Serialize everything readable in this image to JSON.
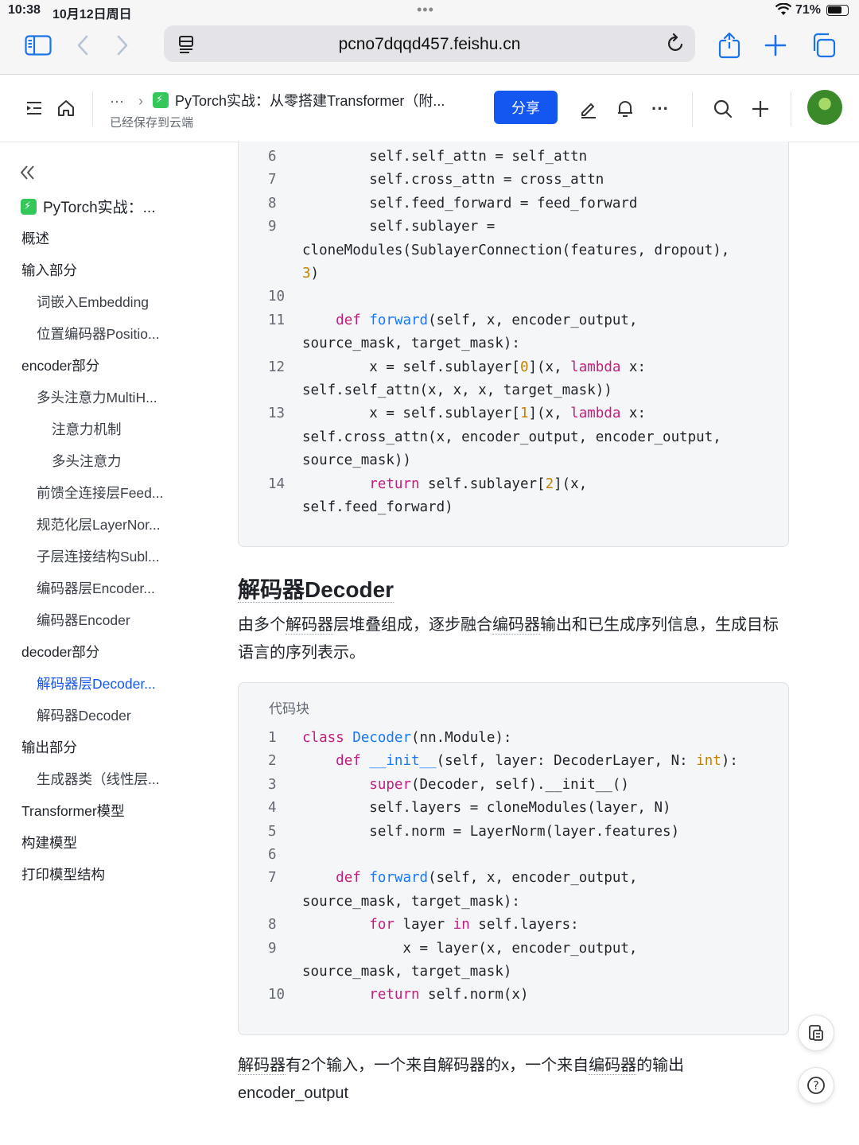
{
  "status": {
    "time": "10:38",
    "date": "10月12日周日",
    "battery": "71%"
  },
  "browser": {
    "url": "pcno7dqqd457.feishu.cn"
  },
  "doc": {
    "crumb_ellipsis": "···",
    "title": "PyTorch实战：从零搭建Transformer（附...",
    "saved": "已经保存到云端",
    "share_label": "分享"
  },
  "toc": {
    "title": "PyTorch实战：...",
    "items": [
      {
        "label": "概述",
        "level": 1
      },
      {
        "label": "输入部分",
        "level": 1
      },
      {
        "label": "词嵌入Embedding",
        "level": 2
      },
      {
        "label": "位置编码器Positio...",
        "level": 2
      },
      {
        "label": "encoder部分",
        "level": 1
      },
      {
        "label": "多头注意力MultiH...",
        "level": 2
      },
      {
        "label": "注意力机制",
        "level": 3
      },
      {
        "label": "多头注意力",
        "level": 3
      },
      {
        "label": "前馈全连接层Feed...",
        "level": 2
      },
      {
        "label": "规范化层LayerNor...",
        "level": 2
      },
      {
        "label": "子层连接结构Subl...",
        "level": 2
      },
      {
        "label": "编码器层Encoder...",
        "level": 2
      },
      {
        "label": "编码器Encoder",
        "level": 2
      },
      {
        "label": "decoder部分",
        "level": 1
      },
      {
        "label": "解码器层Decoder...",
        "level": 2,
        "active": true
      },
      {
        "label": "解码器Decoder",
        "level": 2
      },
      {
        "label": "输出部分",
        "level": 1
      },
      {
        "label": "生成器类（线性层...",
        "level": 2
      },
      {
        "label": "Transformer模型",
        "level": 1
      },
      {
        "label": "构建模型",
        "level": 1
      },
      {
        "label": "打印模型结构",
        "level": 1
      }
    ]
  },
  "code1": {
    "lines": [
      {
        "n": "6",
        "t": "        self.self_attn = self_attn"
      },
      {
        "n": "7",
        "t": "        self.cross_attn = cross_attn"
      },
      {
        "n": "8",
        "t": "        self.feed_forward = feed_forward"
      },
      {
        "n": "9",
        "t": "        self.sublayer ="
      },
      {
        "n": "",
        "t": "cloneModules(SublayerConnection(features, dropout),"
      },
      {
        "n": "",
        "t": "3)"
      },
      {
        "n": "10",
        "t": ""
      },
      {
        "n": "11",
        "t": "    def forward(self, x, encoder_output,"
      },
      {
        "n": "",
        "t": "source_mask, target_mask):"
      },
      {
        "n": "12",
        "t": "        x = self.sublayer[0](x, lambda x:"
      },
      {
        "n": "",
        "t": "self.self_attn(x, x, x, target_mask))"
      },
      {
        "n": "13",
        "t": "        x = self.sublayer[1](x, lambda x:"
      },
      {
        "n": "",
        "t": "self.cross_attn(x, encoder_output, encoder_output,"
      },
      {
        "n": "",
        "t": "source_mask))"
      },
      {
        "n": "14",
        "t": "        return self.sublayer[2](x,"
      },
      {
        "n": "",
        "t": "self.feed_forward)"
      }
    ]
  },
  "section": {
    "heading": "解码器Decoder",
    "para_a": "由多个",
    "para_b": "解码器",
    "para_c": "层堆叠组成，逐步融合",
    "para_d": "编码器",
    "para_e": "输出和已生成序列信息，生成目标语言的序列表示。"
  },
  "code2": {
    "label": "代码块",
    "lines": [
      {
        "n": "1",
        "t": "class Decoder(nn.Module):"
      },
      {
        "n": "2",
        "t": "    def __init__(self, layer: DecoderLayer, N: int):"
      },
      {
        "n": "3",
        "t": "        super(Decoder, self).__init__()"
      },
      {
        "n": "4",
        "t": "        self.layers = cloneModules(layer, N)"
      },
      {
        "n": "5",
        "t": "        self.norm = LayerNorm(layer.features)"
      },
      {
        "n": "6",
        "t": ""
      },
      {
        "n": "7",
        "t": "    def forward(self, x, encoder_output,"
      },
      {
        "n": "",
        "t": "source_mask, target_mask):"
      },
      {
        "n": "8",
        "t": "        for layer in self.layers:"
      },
      {
        "n": "9",
        "t": "            x = layer(x, encoder_output,"
      },
      {
        "n": "",
        "t": "source_mask, target_mask)"
      },
      {
        "n": "10",
        "t": "        return self.norm(x)"
      }
    ]
  },
  "para2": {
    "a": "解码器",
    "b": "有2个输入，一个来自解码器的x，一个来自",
    "c": "编码器",
    "d": "的输出",
    "e": "encoder_output"
  },
  "colors": {
    "accent": "#1456f0",
    "keyword": "#c41d7f",
    "function": "#1677ff",
    "number": "#c78100"
  },
  "icons": [
    "sidebar-icon",
    "back-icon",
    "forward-icon",
    "page-icon",
    "reload-icon",
    "share-sheet-icon",
    "new-tab-icon",
    "tabs-icon",
    "toc-icon",
    "home-icon",
    "chevron-right-icon",
    "lightning-icon",
    "edit-icon",
    "bell-icon",
    "more-icon",
    "search-icon",
    "plus-icon",
    "collapse-icon",
    "copy-doc-icon",
    "help-icon"
  ]
}
